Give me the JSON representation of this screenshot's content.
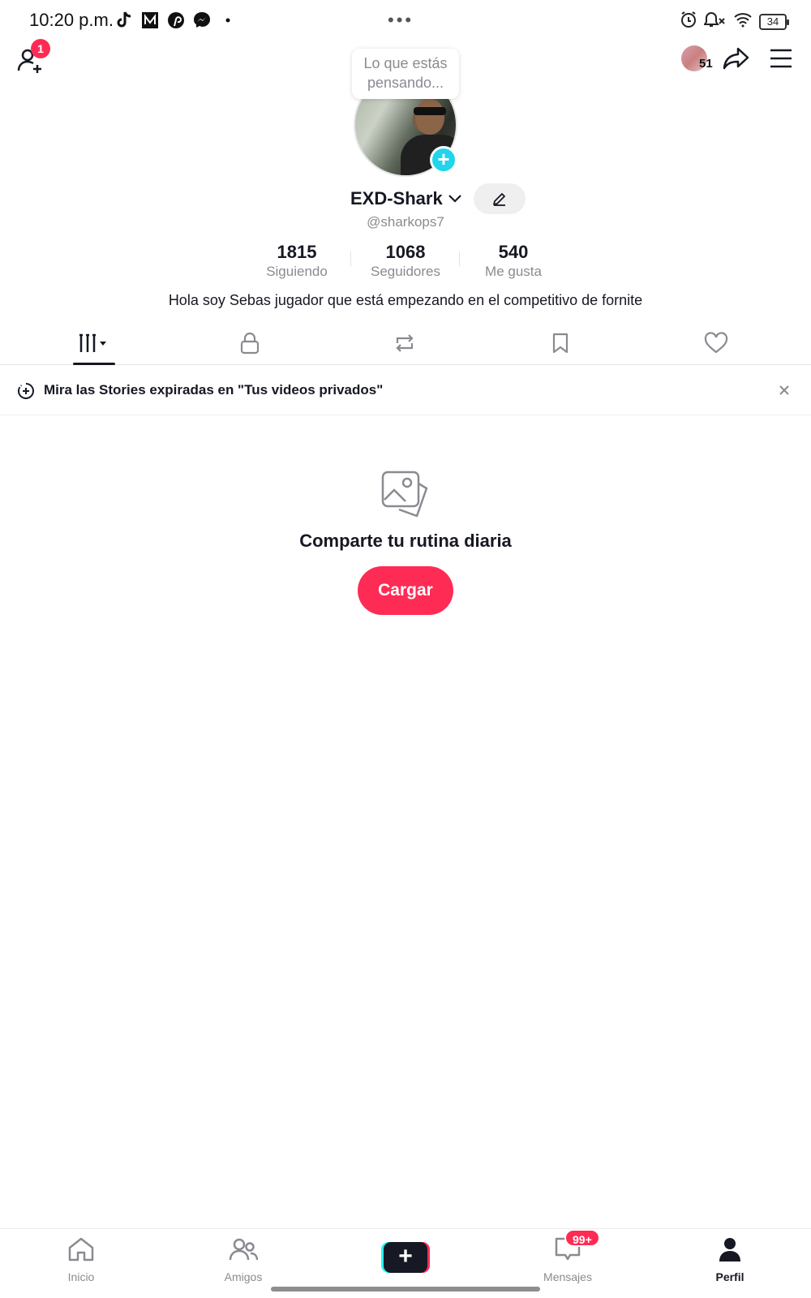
{
  "status_bar": {
    "time": "10:20 p.m.",
    "app_icons": [
      "tiktok-icon",
      "medium-icon",
      "pinterest-icon",
      "messenger-icon",
      "dot-icon"
    ],
    "battery": "34"
  },
  "top_bar": {
    "notification_count": "1",
    "stories_count": "51"
  },
  "profile": {
    "thought_bubble": "Lo que estás pensando...",
    "display_name": "EXD-Shark",
    "username": "@sharkops7",
    "stats": [
      {
        "value": "1815",
        "label": "Siguiendo"
      },
      {
        "value": "1068",
        "label": "Seguidores"
      },
      {
        "value": "540",
        "label": "Me gusta"
      }
    ],
    "bio": "Hola soy Sebas jugador que está empezando en el competitivo de fornite"
  },
  "tabs": [
    "videos-grid-icon",
    "lock-icon",
    "repost-icon",
    "bookmark-icon",
    "heart-icon"
  ],
  "banner": {
    "text": "Mira las Stories expiradas en \"Tus videos privados\""
  },
  "empty_state": {
    "title": "Comparte tu rutina diaria",
    "upload_label": "Cargar"
  },
  "bottom_nav": {
    "items": [
      {
        "label": "Inicio",
        "icon": "home-icon"
      },
      {
        "label": "Amigos",
        "icon": "friends-icon"
      },
      {
        "label": "",
        "icon": "create-icon"
      },
      {
        "label": "Mensajes",
        "icon": "inbox-icon"
      },
      {
        "label": "Perfil",
        "icon": "profile-icon"
      }
    ],
    "messages_badge": "99+"
  },
  "colors": {
    "accent": "#fe2c55",
    "cyan": "#25f4ee",
    "text": "#161823",
    "muted": "#8a8b91"
  }
}
